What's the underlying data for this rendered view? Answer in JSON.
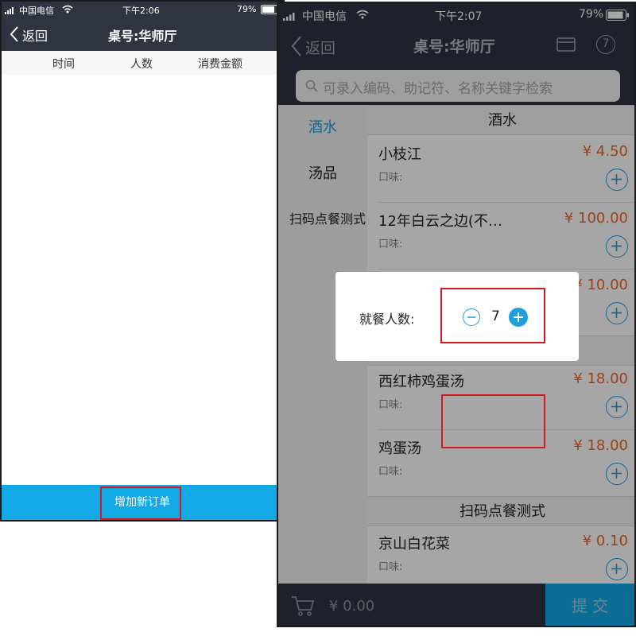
{
  "left": {
    "status": {
      "carrier": "中国电信",
      "time": "下午2:06",
      "battery": "79%"
    },
    "nav": {
      "back_label": "返回",
      "title": "桌号:华师厅"
    },
    "columns": [
      "时间",
      "人数",
      "消费金额"
    ],
    "add_order_label": "增加新订单"
  },
  "right": {
    "status": {
      "carrier": "中国电信",
      "time": "下午2:07",
      "battery": "79%"
    },
    "nav": {
      "back_label": "返回",
      "title": "桌号:华师厅",
      "guest_badge": "7"
    },
    "search": {
      "placeholder": "可录入编码、助记符、名称关键字检索"
    },
    "sidebar": [
      {
        "label": "酒水"
      },
      {
        "label": "汤品"
      },
      {
        "label": "扫码点餐测式"
      }
    ],
    "categories": {
      "drinks": "酒水",
      "scan": "扫码点餐测式"
    },
    "items": [
      {
        "name": "小枝江",
        "price": "¥ 4.50",
        "taste": "口味:"
      },
      {
        "name": "12年白云之边(不…",
        "price": "¥ 100.00",
        "taste": "口味:"
      },
      {
        "name": "",
        "price": "¥ 10.00",
        "taste": ""
      },
      {
        "name": "西红柿鸡蛋汤",
        "price": "¥ 18.00",
        "taste": "口味:"
      },
      {
        "name": "鸡蛋汤",
        "price": "¥ 18.00",
        "taste": "口味:"
      },
      {
        "name": "京山白花菜",
        "price": "¥ 0.10",
        "taste": "口味:"
      }
    ],
    "modal": {
      "label": "就餐人数:",
      "value": "7"
    },
    "footer": {
      "total": "¥ 0.00",
      "submit_label": "提 交"
    }
  },
  "colors": {
    "navbar": "#2f3440",
    "accent": "#13a8e6",
    "price": "#f0652a",
    "highlight": "#d7191f"
  }
}
